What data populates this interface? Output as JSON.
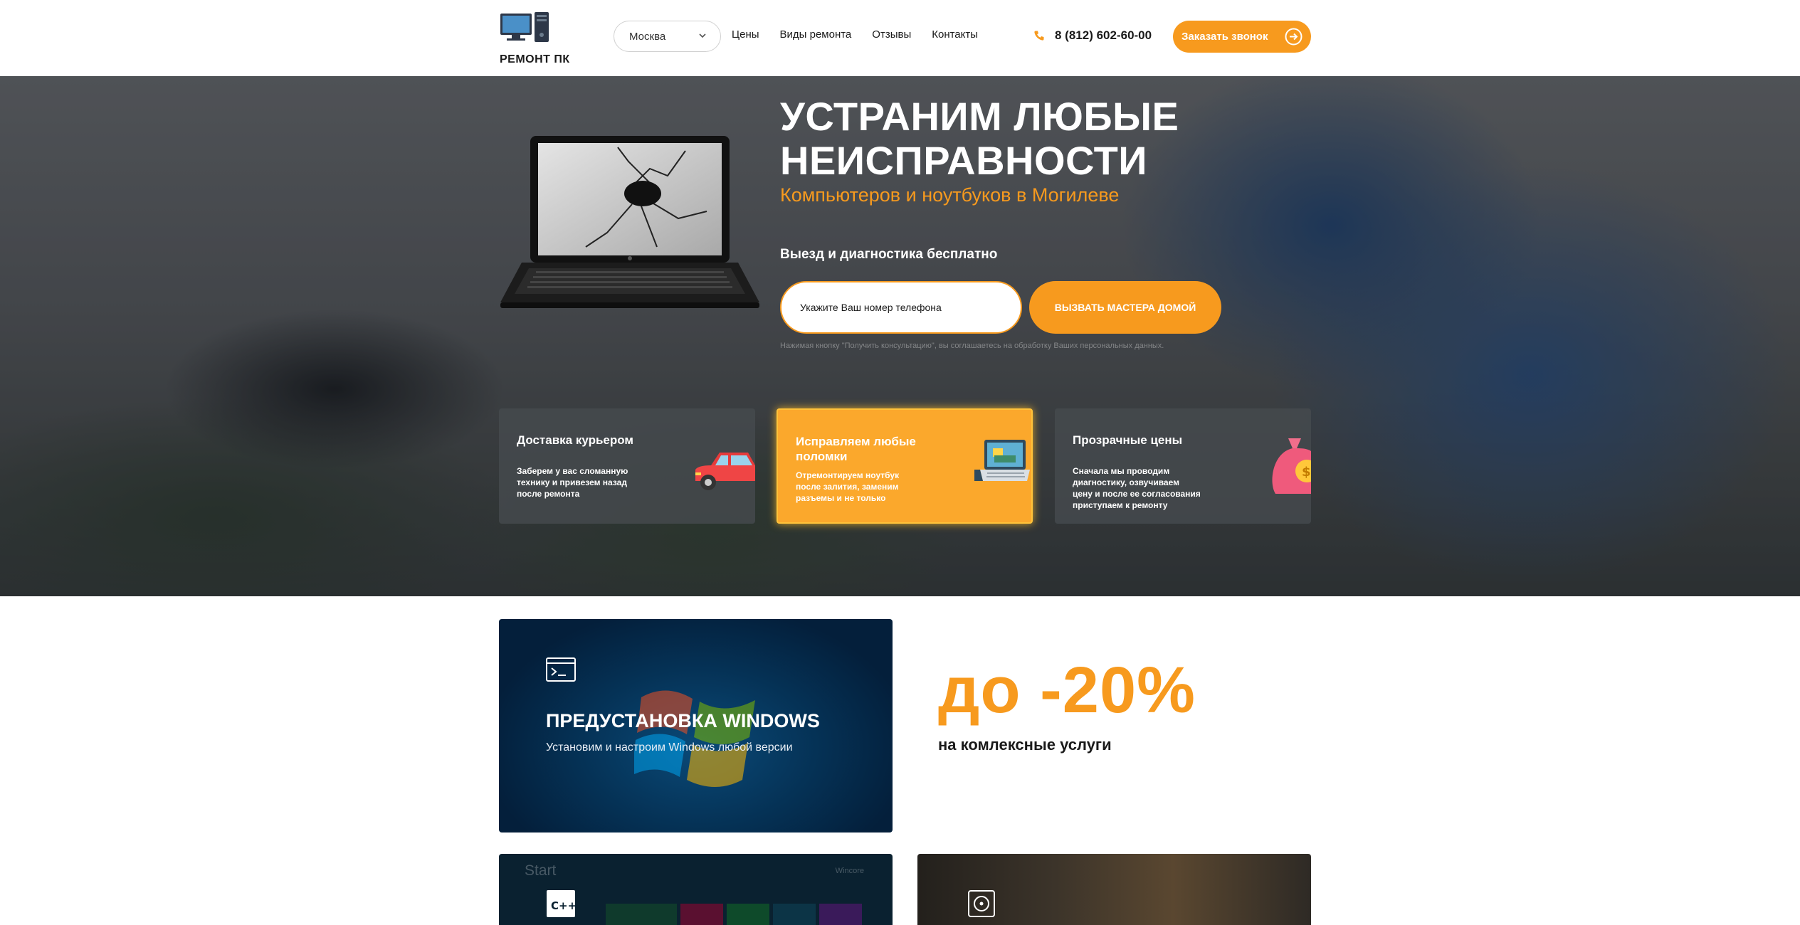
{
  "header": {
    "logo_text": "РЕМОНТ ПК",
    "city": "Москва",
    "nav": [
      "Цены",
      "Виды ремонта",
      "Отзывы",
      "Контакты"
    ],
    "phone": "8 (812) 602-60-00",
    "callback_label": "Заказать звонок"
  },
  "hero": {
    "title_line1": "УСТРАНИМ ЛЮБЫЕ",
    "title_line2": "НЕИСПРАВНОСТИ",
    "subtitle": "Компьютеров и ноутбуков в Могилеве",
    "note": "Выезд и диагностика бесплатно",
    "phone_placeholder": "Укажите Ваш номер телефона",
    "master_button": "ВЫЗВАТЬ МАСТЕРА ДОМОЙ",
    "consent": "Нажимая кнопку \"Получить консультацию\", вы соглашаетесь на обработку Ваших персональных данных."
  },
  "features": [
    {
      "title": "Доставка курьером",
      "text": "Заберем у вас сломанную технику и привезем назад после ремонта",
      "icon": "car-icon"
    },
    {
      "title": "Исправляем любые поломки",
      "text": "Отремонтируем ноутбук после залития, заменим разъемы и не только",
      "icon": "laptop-repair-icon"
    },
    {
      "title": "Прозрачные цены",
      "text": "Сначала мы проводим диагностику, озвучиваем цену и после ее согласования приступаем к ремонту",
      "icon": "money-bag-icon"
    }
  ],
  "services": {
    "windows_title": "ПРЕДУСТАНОВКА WINDOWS",
    "windows_sub": "Установим и настроим Windows любой версии",
    "start_label": "Start",
    "start_user": "Wincore",
    "cpp_label": "C++"
  },
  "promo": {
    "discount": "до -20%",
    "discount_sub": "на комлексные услуги"
  },
  "colors": {
    "accent": "#f79a1e",
    "feature_active": "#fba82c",
    "dark_text": "#1a1a1a"
  }
}
